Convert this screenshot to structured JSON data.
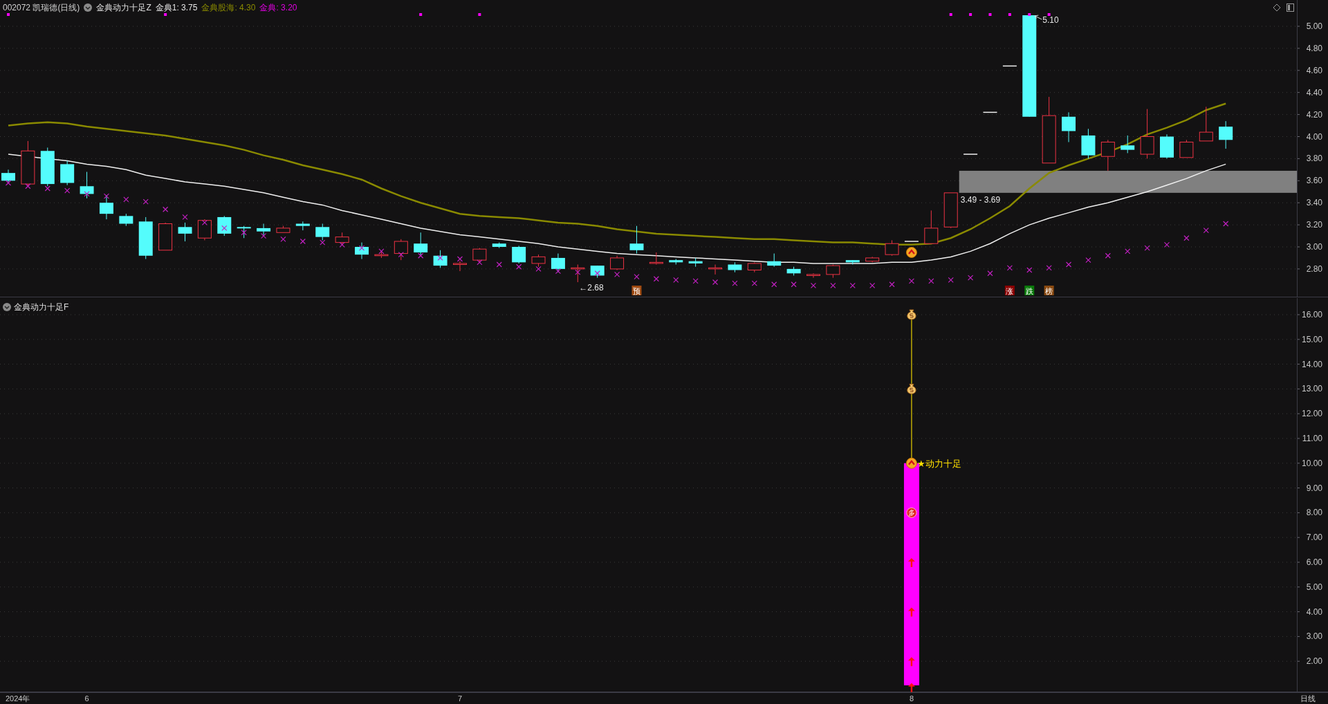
{
  "header": {
    "symbol": "002072 凯瑞德(日线)",
    "indicator": "金典动力十足Z",
    "values": [
      {
        "text": "金典1: 3.75",
        "color": "#e6e6e6"
      },
      {
        "text": "金典股海: 4.30",
        "color": "#8a8a00"
      },
      {
        "text": "金典: 3.20",
        "color": "#e000e0"
      }
    ]
  },
  "main_chart": {
    "axis_labels": [
      "5.00",
      "4.80",
      "4.60",
      "4.40",
      "4.20",
      "4.00",
      "3.80",
      "3.60",
      "3.40",
      "3.20",
      "3.00",
      "2.80"
    ],
    "high_label": "5.10",
    "low_label": "←2.68",
    "zone_label": "3.49 - 3.69",
    "badges": [
      {
        "text": "预",
        "color": "#a04a10"
      },
      {
        "text": "涨",
        "color": "#8b0000"
      },
      {
        "text": "跌",
        "color": "#0a7a0a"
      },
      {
        "text": "榜",
        "color": "#8b4a10"
      }
    ]
  },
  "sub_chart": {
    "title": "金典动力十足F",
    "axis_labels": [
      "16.00",
      "15.00",
      "14.00",
      "13.00",
      "12.00",
      "11.00",
      "10.00",
      "9.00",
      "8.00",
      "7.00",
      "6.00",
      "5.00",
      "4.00",
      "3.00",
      "2.00"
    ],
    "signal_label": "★动力十足",
    "circle_badge": "多"
  },
  "time_axis": [
    "2024年",
    "6",
    "7",
    "8"
  ],
  "period_label": "日线"
}
